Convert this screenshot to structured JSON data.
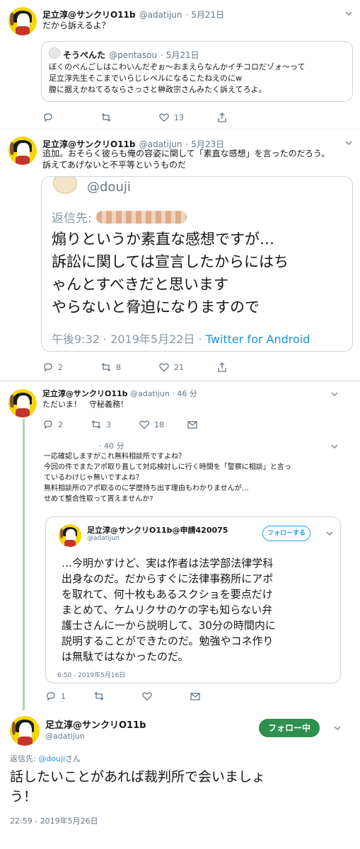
{
  "tweet1": {
    "name": "足立淳@サンクリO11b",
    "handle": "@adatijun",
    "date": "5月21日",
    "text": "だから訴えるよ？",
    "quote": {
      "name": "そうぺんた",
      "handle": "@pentasou",
      "date": "5月21日",
      "lines": [
        "ぼくのぺんごしはこわいんだぞぉ〜おまえらなんかイチコロだゾォ〜って",
        "足立淳先生そこまでいらじレベルになるこたねえのにw",
        "腹に据えかねてるならさっさと榊政宗さんみたく訴えてろよ。"
      ]
    },
    "likes": "13"
  },
  "tweet2": {
    "name": "足立淳@サンクリO11b",
    "handle": "@adatijun",
    "date": "5月23日",
    "lines": [
      "追加。おそらく彼らも俺の容姿に関して「素直な感想」を言ったのだろう。",
      "訴えてあげないと不平等というものだ"
    ],
    "embed": {
      "handle": "@douji",
      "reply_prefix": "返信先:",
      "lines": [
        "煽りというか素直な感想ですが…",
        "訴訟に関しては宣言したからにはち",
        "ゃんとすべきだと思います",
        "やらないと脅迫になりますので"
      ],
      "timestamp": "午後9:32 · 2019年5月22日 · ",
      "source": "Twitter for Android"
    },
    "replies": "2",
    "retweets": "8",
    "likes": "21"
  },
  "tweet3": {
    "name": "足立淳@サンクリO11b",
    "handle": "@adatijun",
    "time": "46 分",
    "text": "ただいま！　守秘義務！",
    "replies": "2",
    "retweets": "3",
    "likes": "18"
  },
  "reply4": {
    "time": "40 分",
    "lines": [
      "一応確認しますがこれ無料相談所ですよね？",
      "今回の件でまたアポ取り直して対応検討しに行く時間を「警察に相談」と言っ",
      "ているわけじゃ無いですよね？",
      "無料相談所のアポ取るのに学歴持ち出す理由もわかりませんが…",
      "せめて整合性取って貰えませんか?"
    ],
    "quote": {
      "name": "足立淳@サンクリO11b@申請420075",
      "handle": "@adatijun",
      "follow_label": "フォローする",
      "lines": [
        "…今明かすけど、実は作者は法学部法律学科",
        "出身なのだ。だからすぐに法律事務所にアポ",
        "を取れて、何十枚もあるスクショを要点だけ",
        "まとめて、ケムリクサのケの字も知らない弁",
        "護士さんに一から説明して、30分の時間内に",
        "説明することができたのだ。勉強やコネ作り",
        "は無駄ではなかったのだ。"
      ],
      "timestamp": "6:50 - 2019年5月16日"
    },
    "replies": "1"
  },
  "tweet5": {
    "name": "足立淳@サンクリO11b",
    "handle": "@adatijun",
    "following_label": "フォロー中",
    "reply_prefix": "返信先: ",
    "reply_handle": "@douji",
    "reply_suffix": "さん",
    "lines": [
      "話したいことがあれば裁判所で会いましょ",
      "う！"
    ],
    "timestamp": "22:59 - 2019年5月26日"
  },
  "colors": {
    "accent": "#1da1f2",
    "link": "#1b95e0",
    "follow_green": "#2f8f4f",
    "thread_line": "#a3d9b1",
    "avatar_yellow": "#f6d60a"
  }
}
